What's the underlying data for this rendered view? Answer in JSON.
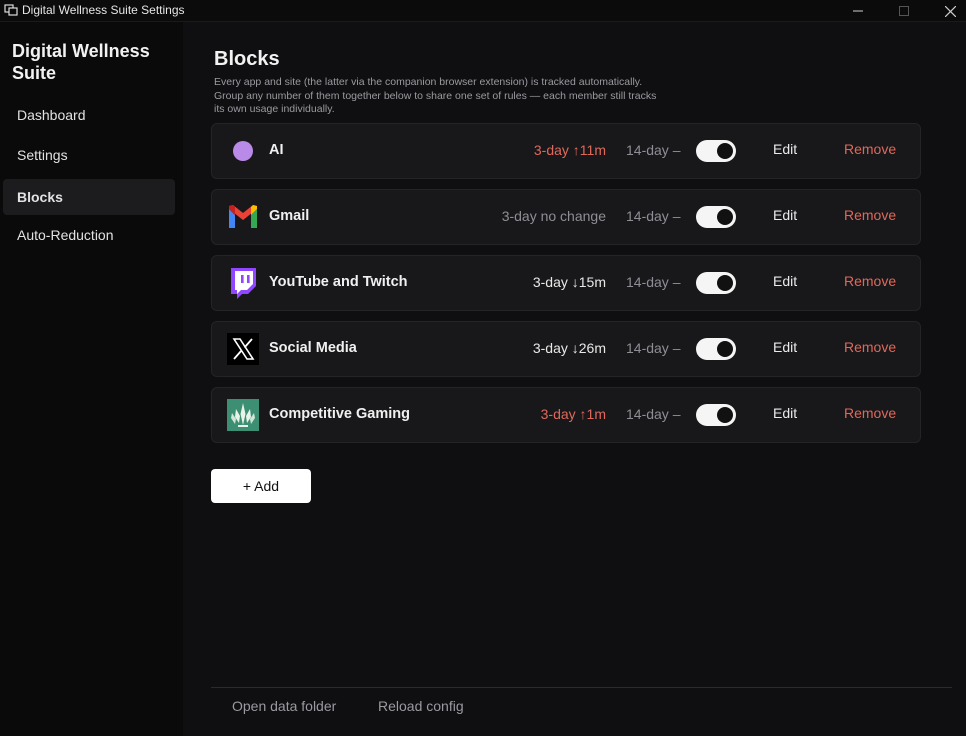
{
  "window": {
    "title": "Digital Wellness Suite Settings"
  },
  "sidebar": {
    "brand": "Digital Wellness Suite",
    "items": [
      {
        "label": "Dashboard",
        "active": false
      },
      {
        "label": "Settings",
        "active": false
      },
      {
        "label": "Blocks",
        "active": true
      },
      {
        "label": "Auto-Reduction",
        "active": false
      }
    ]
  },
  "main": {
    "title": "Blocks",
    "description": "Every app and site (the latter via the companion browser extension) is tracked automatically. Group any number of them together below to share one set of rules — each member still tracks its own usage individually.",
    "blocks": [
      {
        "name": "AI",
        "icon": "purple-dot-icon",
        "trend3": "3-day ↑11m",
        "trend3_tone": "up",
        "trend14": "14-day –",
        "enabled": true,
        "edit_label": "Edit",
        "remove_label": "Remove"
      },
      {
        "name": "Gmail",
        "icon": "gmail-icon",
        "trend3": "3-day no change",
        "trend3_tone": "neutral",
        "trend14": "14-day –",
        "enabled": true,
        "edit_label": "Edit",
        "remove_label": "Remove"
      },
      {
        "name": "YouTube and Twitch",
        "icon": "twitch-icon",
        "trend3": "3-day ↓15m",
        "trend3_tone": "down",
        "trend14": "14-day –",
        "enabled": true,
        "edit_label": "Edit",
        "remove_label": "Remove"
      },
      {
        "name": "Social Media",
        "icon": "x-icon",
        "trend3": "3-day ↓26m",
        "trend3_tone": "down",
        "trend14": "14-day –",
        "enabled": true,
        "edit_label": "Edit",
        "remove_label": "Remove"
      },
      {
        "name": "Competitive Gaming",
        "icon": "gaming-icon",
        "trend3": "3-day ↑1m",
        "trend3_tone": "up",
        "trend14": "14-day –",
        "enabled": true,
        "edit_label": "Edit",
        "remove_label": "Remove"
      }
    ],
    "add_label": "+ Add"
  },
  "footer": {
    "open_data_folder": "Open data folder",
    "reload_config": "Reload config"
  },
  "colors": {
    "accent_red": "#e0685b",
    "ai_dot": "#b98ae8",
    "twitch": "#9146ff",
    "gaming_bg": "#3d8f74"
  }
}
